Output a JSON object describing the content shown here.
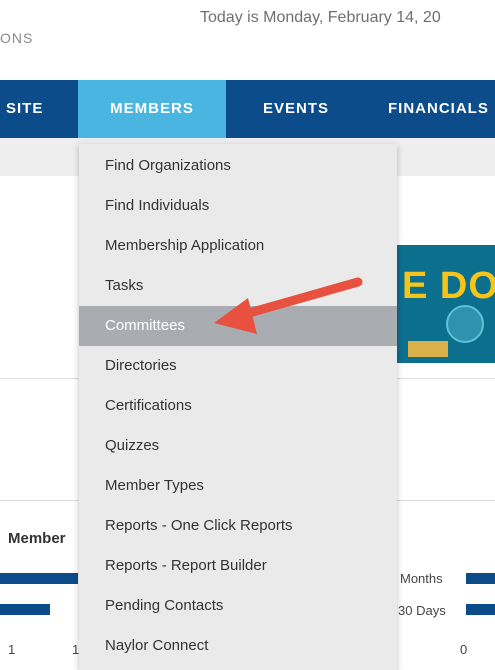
{
  "header": {
    "logo_top": "",
    "logo_sub": "ONS",
    "date_text": "Today is Monday, February 14, 20"
  },
  "nav": {
    "items": [
      {
        "label": "SITE"
      },
      {
        "label": "MEMBERS"
      },
      {
        "label": "EVENTS"
      },
      {
        "label": "FINANCIALS"
      }
    ],
    "active": "MEMBERS"
  },
  "dropdown": {
    "items": [
      {
        "label": "Find Organizations"
      },
      {
        "label": "Find Individuals"
      },
      {
        "label": "Membership Application"
      },
      {
        "label": "Tasks"
      },
      {
        "label": "Committees"
      },
      {
        "label": "Directories"
      },
      {
        "label": "Certifications"
      },
      {
        "label": "Quizzes"
      },
      {
        "label": "Member Types"
      },
      {
        "label": "Reports - One Click Reports"
      },
      {
        "label": "Reports - Report Builder"
      },
      {
        "label": "Pending Contacts"
      },
      {
        "label": "Naylor Connect"
      }
    ],
    "highlighted": "Committees"
  },
  "banner": {
    "text": "E DOI"
  },
  "widgets": {
    "members_label": "Member",
    "months_label": "Months",
    "days_label": "30 Days",
    "num_left": "1",
    "num_left2": "1",
    "num_right": "0"
  },
  "colors": {
    "nav_bg": "#0c4c8a",
    "nav_active": "#49b5e0",
    "dropdown_bg": "#eaeaea",
    "dropdown_active": "#a9acb0",
    "arrow": "#e8503f"
  }
}
